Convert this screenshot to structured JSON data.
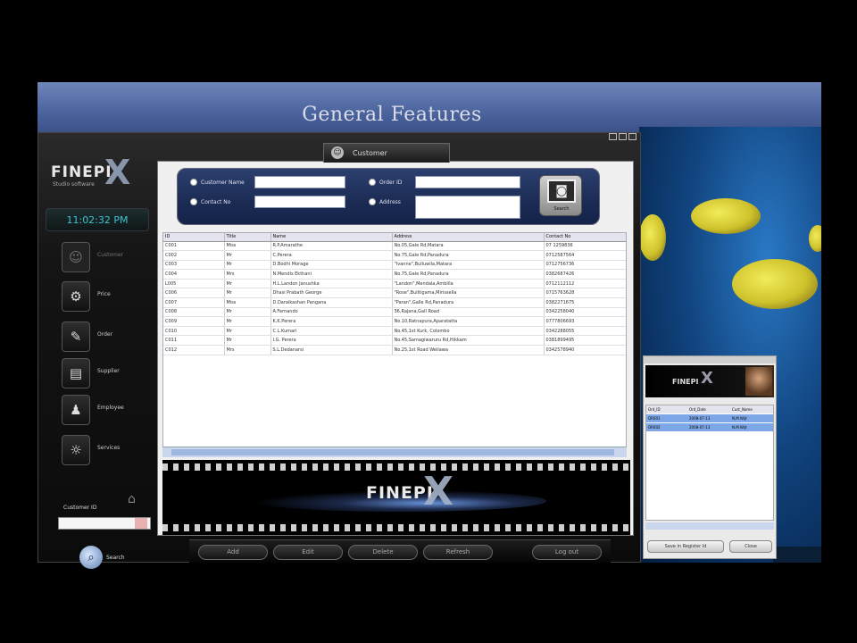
{
  "slide": {
    "title": "General Features"
  },
  "app": {
    "logo": "FINEPI",
    "logo_sub": "Studio software",
    "clock": "11:02:32 PM",
    "nav": [
      {
        "label": "Customer",
        "icon": "customer-icon",
        "active": false
      },
      {
        "label": "Price",
        "icon": "price-icon",
        "active": true
      },
      {
        "label": "Order",
        "icon": "order-icon",
        "active": true
      },
      {
        "label": "Supplier",
        "icon": "supplier-icon",
        "active": true
      },
      {
        "label": "Employee",
        "icon": "employee-icon",
        "active": true
      },
      {
        "label": "Services",
        "icon": "services-icon",
        "active": true
      }
    ],
    "customer_id_label": "Customer ID",
    "customer_id_value": "",
    "search_label": "Search"
  },
  "tab": {
    "label": "Customer"
  },
  "filters": {
    "customer_name_label": "Customer Name",
    "contact_no_label": "Contact No",
    "order_id_label": "Order ID",
    "address_label": "Address",
    "customer_name_value": "",
    "contact_no_value": "",
    "order_id_value": "",
    "address_value": "",
    "camera_label": "Search"
  },
  "table": {
    "columns": [
      "ID",
      "Title",
      "Name",
      "Address",
      "Contact No"
    ],
    "rows": [
      [
        "C001",
        "Miss",
        "R.P.Amarathe",
        "No.05,Gale Rd,Matara",
        "07 1259836"
      ],
      [
        "C002",
        "Mr",
        "C.Perera",
        "No.75,Gale Rd,Panadura",
        "0712587564"
      ],
      [
        "C003",
        "Mr",
        "D.Bodhi Morage",
        "\"Ivanne\",Bulluwila,Matara",
        "0712756736"
      ],
      [
        "C004",
        "Mrs",
        "N.Mendis Ekthani",
        "No.75,Gale Rd,Panadura",
        "0382687426"
      ],
      [
        "L005",
        "Mr",
        "H.L.Landon Janushka",
        "\"Landon\",Mendala,Ambilla",
        "0712112112"
      ],
      [
        "C006",
        "Mr",
        "Dhasi Prabath George",
        "\"Rose\",Bulitigama,Mirissella",
        "0715763628"
      ],
      [
        "C007",
        "Miss",
        "D.Daraikashan Pangana",
        "\"Paran\",Galle Rd,Panadura",
        "0382271675"
      ],
      [
        "C008",
        "Mr",
        "A.Fernando",
        "36,Rajana,Gall Road",
        "0342258040"
      ],
      [
        "C009",
        "Mr",
        "K.K.Perera",
        "No.10,Ratnapura,Aparatatta",
        "0777806693"
      ],
      [
        "C010",
        "Mr",
        "C.L.Kumari",
        "No.45,1st Kurk, Colombo",
        "0342288055"
      ],
      [
        "C011",
        "Mr",
        "I.G. Perera",
        "No.45,Samagiwaruru Rd,Hikkam",
        "0381899495"
      ],
      [
        "C012",
        "Mrs",
        "S.L.Dedanarsi",
        "No.25,1st Road Wellawa",
        "0342578940"
      ]
    ]
  },
  "film": {
    "logo": "FINEPI"
  },
  "bottom_buttons": [
    "Add",
    "Edit",
    "Delete",
    "Refresh",
    "Log out"
  ],
  "mini": {
    "logo": "FINEPI",
    "columns": [
      "Ord_ID",
      "Ord_Date",
      "Cust_Name"
    ],
    "rows": [
      [
        "OR001",
        "2008-07-13",
        "N.M.Wijt"
      ],
      [
        "OR002",
        "2008-07-13",
        "N.M.Wijt"
      ]
    ],
    "button_left": "Save in Register Id",
    "button_right": "Close"
  },
  "colors": {
    "header_blue": "#5670a8",
    "window_dark": "#141414",
    "selection_blue": "#7ea7e8",
    "accent_clock": "#3ec2cf"
  }
}
